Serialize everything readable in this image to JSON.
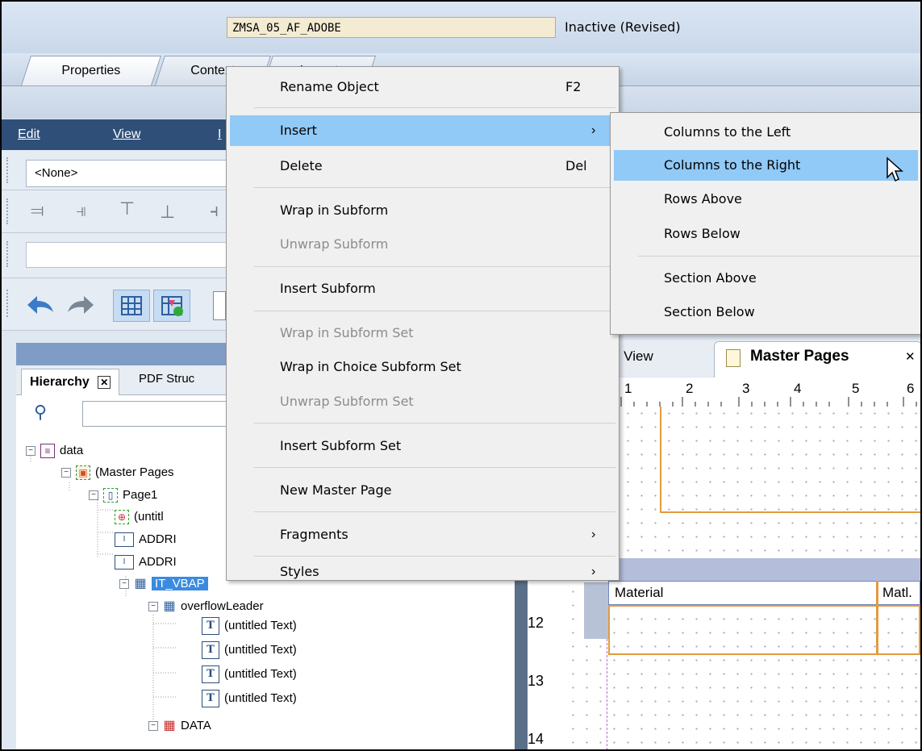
{
  "header": {
    "program_name": "ZMSA_05_AF_ADOBE",
    "status": "Inactive (Revised)"
  },
  "tabs": {
    "properties": "Properties",
    "context": "Context",
    "layout": "Layout"
  },
  "designer": {
    "menu": {
      "edit": "Edit",
      "view": "View",
      "insert_stub": "I"
    },
    "style_select": "<None>",
    "hierarchy_tab": "Hierarchy",
    "pdf_tab": "PDF Struc",
    "design_view_tab": "n View",
    "master_pages_tab": "Master Pages",
    "ruler_top": [
      "1",
      "2",
      "3",
      "4",
      "5",
      "6"
    ],
    "ruler_left": [
      "12",
      "13",
      "14"
    ],
    "column_material": "Material",
    "column_matl": "Matl."
  },
  "tree": {
    "data": "data",
    "master_pages": "(Master Pages",
    "page1": "Page1",
    "untitled": "(untitl",
    "addr1": "ADDRI",
    "addr2": "ADDRI",
    "it_vbap": "IT_VBAP",
    "overflow_leader": "overflowLeader",
    "text1": "(untitled Text)",
    "text2": "(untitled Text)",
    "text3": "(untitled Text)",
    "text4": "(untitled Text)",
    "data_node": "DATA"
  },
  "context_menu": {
    "rename": {
      "label": "Rename Object",
      "shortcut": "F2"
    },
    "insert": {
      "label": "Insert",
      "arrow": "›"
    },
    "delete": {
      "label": "Delete",
      "shortcut": "Del"
    },
    "wrap_subform": {
      "label": "Wrap in Subform"
    },
    "unwrap_subform": {
      "label": "Unwrap Subform"
    },
    "insert_subform": {
      "label": "Insert Subform"
    },
    "wrap_subform_set": {
      "label": "Wrap in Subform Set"
    },
    "wrap_choice_subform_set": {
      "label": "Wrap in Choice Subform Set"
    },
    "unwrap_subform_set": {
      "label": "Unwrap Subform Set"
    },
    "insert_subform_set": {
      "label": "Insert Subform Set"
    },
    "new_master_page": {
      "label": "New Master Page"
    },
    "fragments": {
      "label": "Fragments",
      "arrow": "›"
    },
    "styles": {
      "label": "Styles",
      "arrow": "›"
    }
  },
  "submenu": {
    "columns_left": "Columns to the Left",
    "columns_right": "Columns to the Right",
    "rows_above": "Rows Above",
    "rows_below": "Rows Below",
    "section_above": "Section Above",
    "section_below": "Section Below"
  },
  "colors": {
    "menu_highlight": "#91c9f7",
    "program_field": "#f4ecd2",
    "tree_selection": "#3a8be0",
    "table_border": "#e39a3d"
  }
}
